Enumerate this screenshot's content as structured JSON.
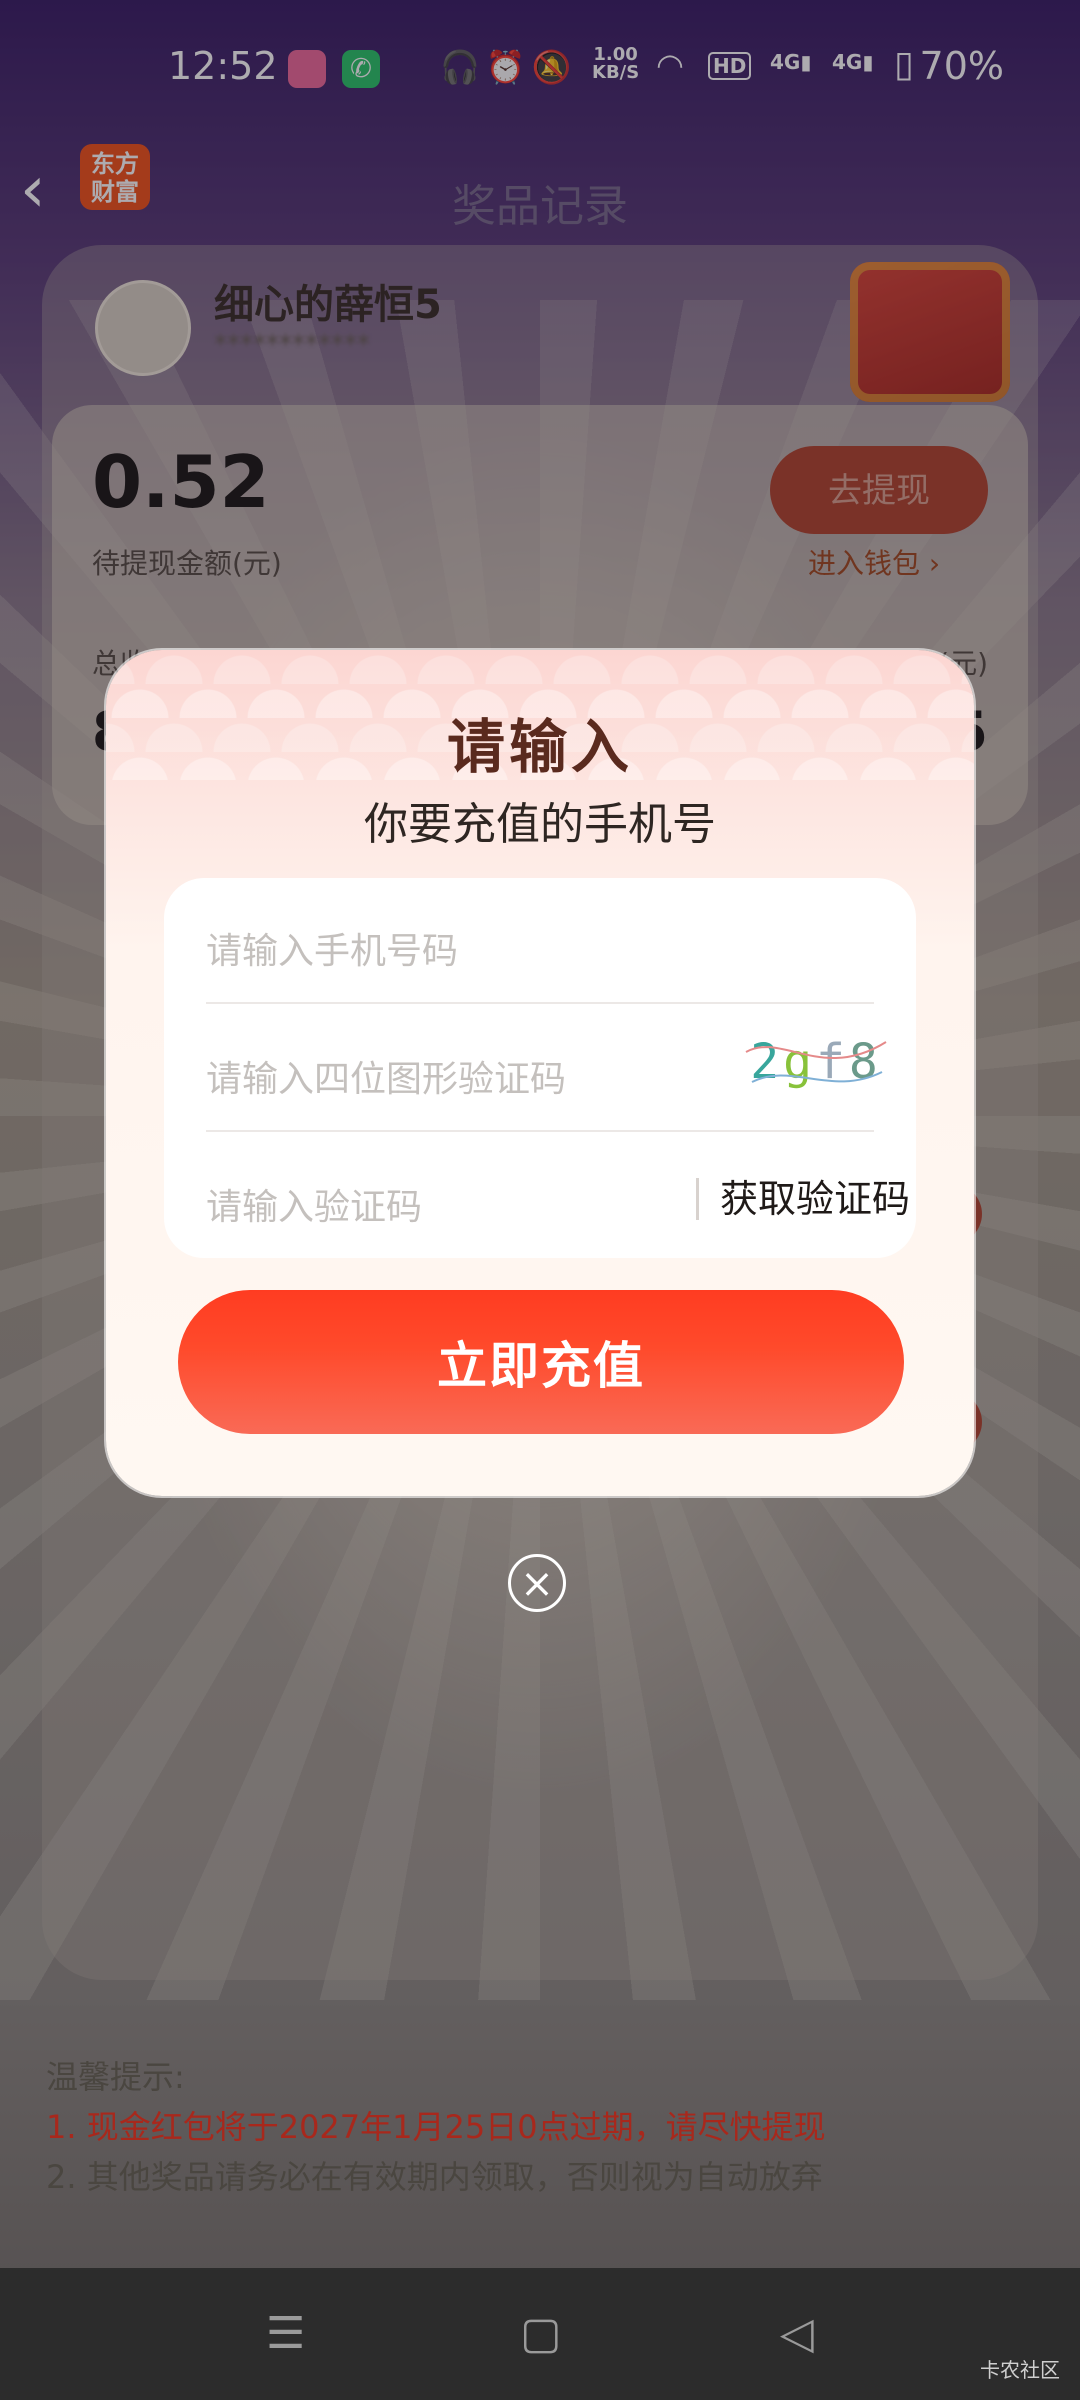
{
  "status_bar": {
    "time": "12:52",
    "network_speed_value": "1.00",
    "network_speed_unit": "KB/S",
    "signal_1": "4G",
    "signal_2": "4G",
    "battery": "70%"
  },
  "nav": {
    "title": "奖品记录",
    "logo_text_line1": "东方",
    "logo_text_line2": "财富"
  },
  "profile": {
    "username": "细心的薛恒5",
    "user_id": "************"
  },
  "wallet": {
    "amount": "0.52",
    "amount_label": "待提现金额(元)",
    "withdraw_button": "去提现",
    "wallet_link": "进入钱包",
    "total_label": "总收",
    "right_label": "(元)",
    "total_left": "8",
    "total_right": "5"
  },
  "modal": {
    "title": "请输入",
    "subtitle": "你要充值的手机号",
    "phone_placeholder": "请输入手机号码",
    "captcha_placeholder": "请输入四位图形验证码",
    "captcha_chars": [
      "2",
      "g",
      "f",
      "8"
    ],
    "code_placeholder": "请输入验证码",
    "get_code_button": "获取验证码",
    "recharge_button": "立即充值"
  },
  "tips": {
    "heading": "温馨提示:",
    "line1": "1. 现金红包将于2027年1月25日0点过期，请尽快提现",
    "line2": "2. 其他奖品请务必在有效期内领取，否则视为自动放弃"
  },
  "bottom_nav": {
    "watermark": "卡农社区"
  },
  "colors": {
    "accent_red": "#ff3c21",
    "tip_red": "#a8281c",
    "captcha_teal": "#38a69c"
  }
}
